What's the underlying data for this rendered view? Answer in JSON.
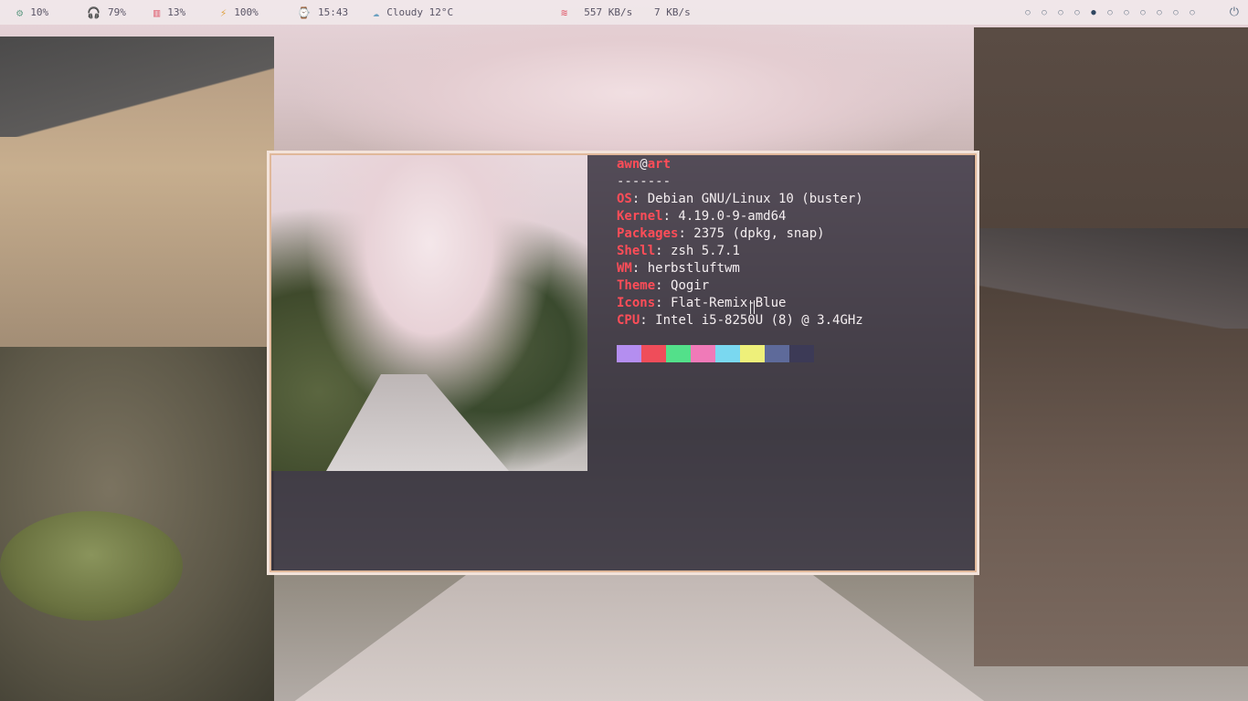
{
  "topbar": {
    "modules": [
      {
        "icon": "cpu-icon",
        "glyph": "⚙",
        "value": "10%",
        "color": "#6aa08a"
      },
      {
        "icon": "headphones-icon",
        "glyph": "🎧",
        "value": "79%",
        "color": "#e08a4a"
      },
      {
        "icon": "memory-icon",
        "glyph": "▥",
        "value": "13%",
        "color": "#e06a7a"
      },
      {
        "icon": "battery-bolt-icon",
        "glyph": "⚡",
        "value": "100%",
        "color": "#e0a040"
      },
      {
        "icon": "clock-icon",
        "glyph": "⌚",
        "value": "15:43",
        "color": "#4aa07a"
      },
      {
        "icon": "weather-icon",
        "glyph": "☁",
        "value": "Cloudy 12°C",
        "color": "#6aa0c0"
      },
      {
        "icon": "wifi-icon",
        "glyph": "≋",
        "value": "557 KB/s",
        "color": "#e05a6a"
      },
      {
        "icon": "upload-icon",
        "glyph": "",
        "value": "7 KB/s",
        "color": "#5a5566"
      }
    ],
    "workspaces": [
      "○",
      "○",
      "○",
      "○",
      "●",
      "○",
      "○",
      "○",
      "○",
      "○",
      "○"
    ],
    "active_workspace": 5,
    "power_glyph": "⏻"
  },
  "terminal": {
    "user": "awn",
    "at": "@",
    "host": "art",
    "separator": "-------",
    "rows": [
      {
        "key": "OS",
        "value": ": Debian GNU/Linux 10 (buster)"
      },
      {
        "key": "Kernel",
        "value": ": 4.19.0-9-amd64"
      },
      {
        "key": "Packages",
        "value": ": 2375 (dpkg, snap)"
      },
      {
        "key": "Shell",
        "value": ": zsh 5.7.1"
      },
      {
        "key": "WM",
        "value": ": herbstluftwm"
      },
      {
        "key": "Theme",
        "value": ": Qogir"
      },
      {
        "key": "Icons",
        "value": ": Flat-Remix-Blue"
      },
      {
        "key": "CPU",
        "value": ": Intel i5-8250U (8) @ 3.4GHz"
      }
    ],
    "palette": [
      "#b48ef0",
      "#ef4d5a",
      "#53e08a",
      "#f07ab8",
      "#7ad8f0",
      "#eef07a",
      "#5e6a9a",
      "#3c3a56"
    ]
  }
}
